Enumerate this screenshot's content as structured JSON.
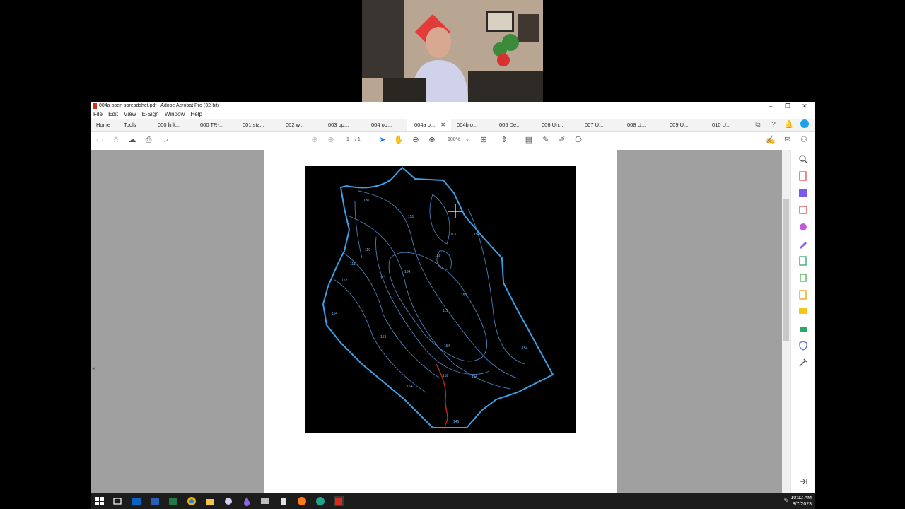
{
  "window": {
    "title": "004a open spreadshet.pdf - Adobe Acrobat Pro (32-bit)",
    "controls": {
      "minimize": "–",
      "maximize": "❐",
      "close": "✕"
    }
  },
  "menu": [
    "File",
    "Edit",
    "View",
    "E-Sign",
    "Window",
    "Help"
  ],
  "nav": {
    "home": "Home",
    "tools": "Tools"
  },
  "tabs": [
    {
      "label": "000 link..."
    },
    {
      "label": "000 TR-..."
    },
    {
      "label": "001 sta..."
    },
    {
      "label": "002 w..."
    },
    {
      "label": "003 op..."
    },
    {
      "label": "004 op..."
    },
    {
      "label": "004a o...",
      "active": true
    },
    {
      "label": "004b o..."
    },
    {
      "label": "005 De..."
    },
    {
      "label": "006 Un..."
    },
    {
      "label": "007 U..."
    },
    {
      "label": "008 U..."
    },
    {
      "label": "009 U..."
    },
    {
      "label": "010 U..."
    }
  ],
  "tab_close": "✕",
  "toolbar": {
    "page_current": "1",
    "page_total": "/ 1",
    "zoom": "100%"
  },
  "map": {
    "contour_labels": [
      "130",
      "151",
      "113",
      "154",
      "110",
      "158",
      "111",
      "164",
      "152",
      "151",
      "111",
      "154",
      "153",
      "154",
      "111",
      "154",
      "152",
      "154",
      "164",
      "145"
    ]
  },
  "taskbar": {
    "time": "10:12 AM",
    "date": "3/7/2023"
  },
  "colors": {
    "boundary": "#3aa0e8",
    "contour": "#4a7fb8",
    "stream": "#d0281c",
    "acrobat_red": "#d62b1e"
  }
}
